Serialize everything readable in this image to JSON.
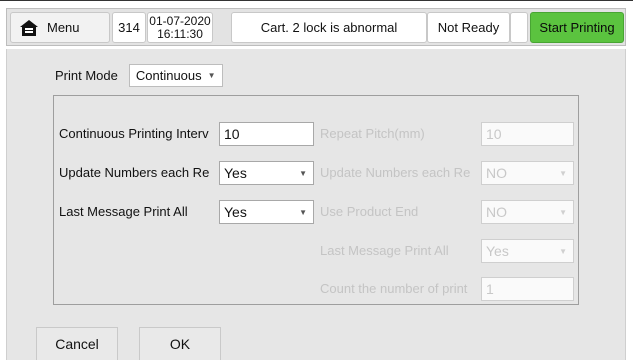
{
  "topbar": {
    "menu_label": "Menu",
    "count": "314",
    "date": "01-07-2020",
    "time": "16:11:30",
    "status_message": "Cart. 2 lock is abnormal",
    "ready_state": "Not Ready",
    "start_label": "Start Printing",
    "start_color": "#5bc33f"
  },
  "print_mode": {
    "label": "Print Mode",
    "value": "Continuous"
  },
  "left_fields": {
    "interval_label": "Continuous Printing Interv",
    "interval_value": "10",
    "update_label": "Update Numbers each Re",
    "update_value": "Yes",
    "last_label": "Last Message Print All",
    "last_value": "Yes"
  },
  "right_fields": {
    "repeat_label": "Repeat Pitch(mm)",
    "repeat_value": "10",
    "update_label": "Update Numbers each Re",
    "update_value": "NO",
    "product_end_label": "Use Product End",
    "product_end_value": "NO",
    "last_label": "Last Message Print All",
    "last_value": "Yes",
    "count_label": "Count the number of print",
    "count_value": "1"
  },
  "buttons": {
    "cancel": "Cancel",
    "ok": "OK"
  }
}
